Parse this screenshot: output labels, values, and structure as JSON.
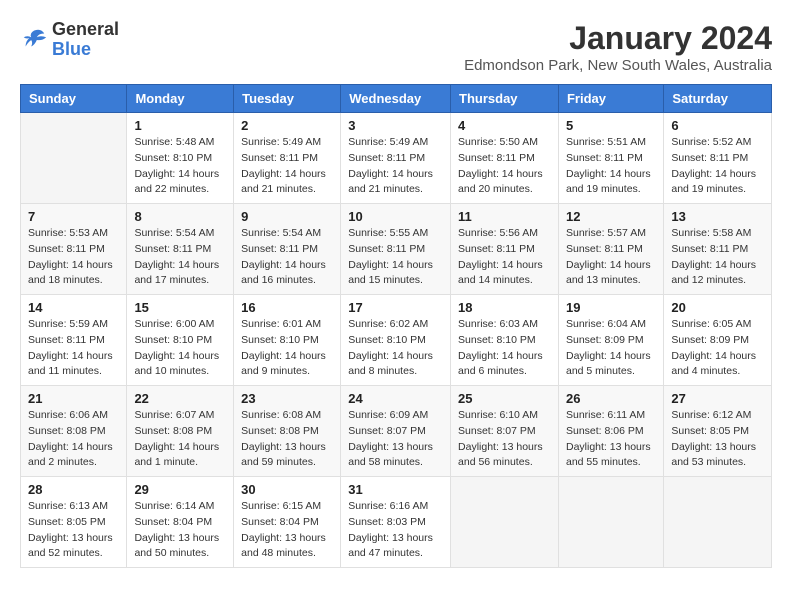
{
  "logo": {
    "general": "General",
    "blue": "Blue"
  },
  "title": "January 2024",
  "subtitle": "Edmondson Park, New South Wales, Australia",
  "days_of_week": [
    "Sunday",
    "Monday",
    "Tuesday",
    "Wednesday",
    "Thursday",
    "Friday",
    "Saturday"
  ],
  "weeks": [
    [
      {
        "num": "",
        "info": ""
      },
      {
        "num": "1",
        "info": "Sunrise: 5:48 AM\nSunset: 8:10 PM\nDaylight: 14 hours\nand 22 minutes."
      },
      {
        "num": "2",
        "info": "Sunrise: 5:49 AM\nSunset: 8:11 PM\nDaylight: 14 hours\nand 21 minutes."
      },
      {
        "num": "3",
        "info": "Sunrise: 5:49 AM\nSunset: 8:11 PM\nDaylight: 14 hours\nand 21 minutes."
      },
      {
        "num": "4",
        "info": "Sunrise: 5:50 AM\nSunset: 8:11 PM\nDaylight: 14 hours\nand 20 minutes."
      },
      {
        "num": "5",
        "info": "Sunrise: 5:51 AM\nSunset: 8:11 PM\nDaylight: 14 hours\nand 19 minutes."
      },
      {
        "num": "6",
        "info": "Sunrise: 5:52 AM\nSunset: 8:11 PM\nDaylight: 14 hours\nand 19 minutes."
      }
    ],
    [
      {
        "num": "7",
        "info": "Sunrise: 5:53 AM\nSunset: 8:11 PM\nDaylight: 14 hours\nand 18 minutes."
      },
      {
        "num": "8",
        "info": "Sunrise: 5:54 AM\nSunset: 8:11 PM\nDaylight: 14 hours\nand 17 minutes."
      },
      {
        "num": "9",
        "info": "Sunrise: 5:54 AM\nSunset: 8:11 PM\nDaylight: 14 hours\nand 16 minutes."
      },
      {
        "num": "10",
        "info": "Sunrise: 5:55 AM\nSunset: 8:11 PM\nDaylight: 14 hours\nand 15 minutes."
      },
      {
        "num": "11",
        "info": "Sunrise: 5:56 AM\nSunset: 8:11 PM\nDaylight: 14 hours\nand 14 minutes."
      },
      {
        "num": "12",
        "info": "Sunrise: 5:57 AM\nSunset: 8:11 PM\nDaylight: 14 hours\nand 13 minutes."
      },
      {
        "num": "13",
        "info": "Sunrise: 5:58 AM\nSunset: 8:11 PM\nDaylight: 14 hours\nand 12 minutes."
      }
    ],
    [
      {
        "num": "14",
        "info": "Sunrise: 5:59 AM\nSunset: 8:11 PM\nDaylight: 14 hours\nand 11 minutes."
      },
      {
        "num": "15",
        "info": "Sunrise: 6:00 AM\nSunset: 8:10 PM\nDaylight: 14 hours\nand 10 minutes."
      },
      {
        "num": "16",
        "info": "Sunrise: 6:01 AM\nSunset: 8:10 PM\nDaylight: 14 hours\nand 9 minutes."
      },
      {
        "num": "17",
        "info": "Sunrise: 6:02 AM\nSunset: 8:10 PM\nDaylight: 14 hours\nand 8 minutes."
      },
      {
        "num": "18",
        "info": "Sunrise: 6:03 AM\nSunset: 8:10 PM\nDaylight: 14 hours\nand 6 minutes."
      },
      {
        "num": "19",
        "info": "Sunrise: 6:04 AM\nSunset: 8:09 PM\nDaylight: 14 hours\nand 5 minutes."
      },
      {
        "num": "20",
        "info": "Sunrise: 6:05 AM\nSunset: 8:09 PM\nDaylight: 14 hours\nand 4 minutes."
      }
    ],
    [
      {
        "num": "21",
        "info": "Sunrise: 6:06 AM\nSunset: 8:08 PM\nDaylight: 14 hours\nand 2 minutes."
      },
      {
        "num": "22",
        "info": "Sunrise: 6:07 AM\nSunset: 8:08 PM\nDaylight: 14 hours\nand 1 minute."
      },
      {
        "num": "23",
        "info": "Sunrise: 6:08 AM\nSunset: 8:08 PM\nDaylight: 13 hours\nand 59 minutes."
      },
      {
        "num": "24",
        "info": "Sunrise: 6:09 AM\nSunset: 8:07 PM\nDaylight: 13 hours\nand 58 minutes."
      },
      {
        "num": "25",
        "info": "Sunrise: 6:10 AM\nSunset: 8:07 PM\nDaylight: 13 hours\nand 56 minutes."
      },
      {
        "num": "26",
        "info": "Sunrise: 6:11 AM\nSunset: 8:06 PM\nDaylight: 13 hours\nand 55 minutes."
      },
      {
        "num": "27",
        "info": "Sunrise: 6:12 AM\nSunset: 8:05 PM\nDaylight: 13 hours\nand 53 minutes."
      }
    ],
    [
      {
        "num": "28",
        "info": "Sunrise: 6:13 AM\nSunset: 8:05 PM\nDaylight: 13 hours\nand 52 minutes."
      },
      {
        "num": "29",
        "info": "Sunrise: 6:14 AM\nSunset: 8:04 PM\nDaylight: 13 hours\nand 50 minutes."
      },
      {
        "num": "30",
        "info": "Sunrise: 6:15 AM\nSunset: 8:04 PM\nDaylight: 13 hours\nand 48 minutes."
      },
      {
        "num": "31",
        "info": "Sunrise: 6:16 AM\nSunset: 8:03 PM\nDaylight: 13 hours\nand 47 minutes."
      },
      {
        "num": "",
        "info": ""
      },
      {
        "num": "",
        "info": ""
      },
      {
        "num": "",
        "info": ""
      }
    ]
  ]
}
